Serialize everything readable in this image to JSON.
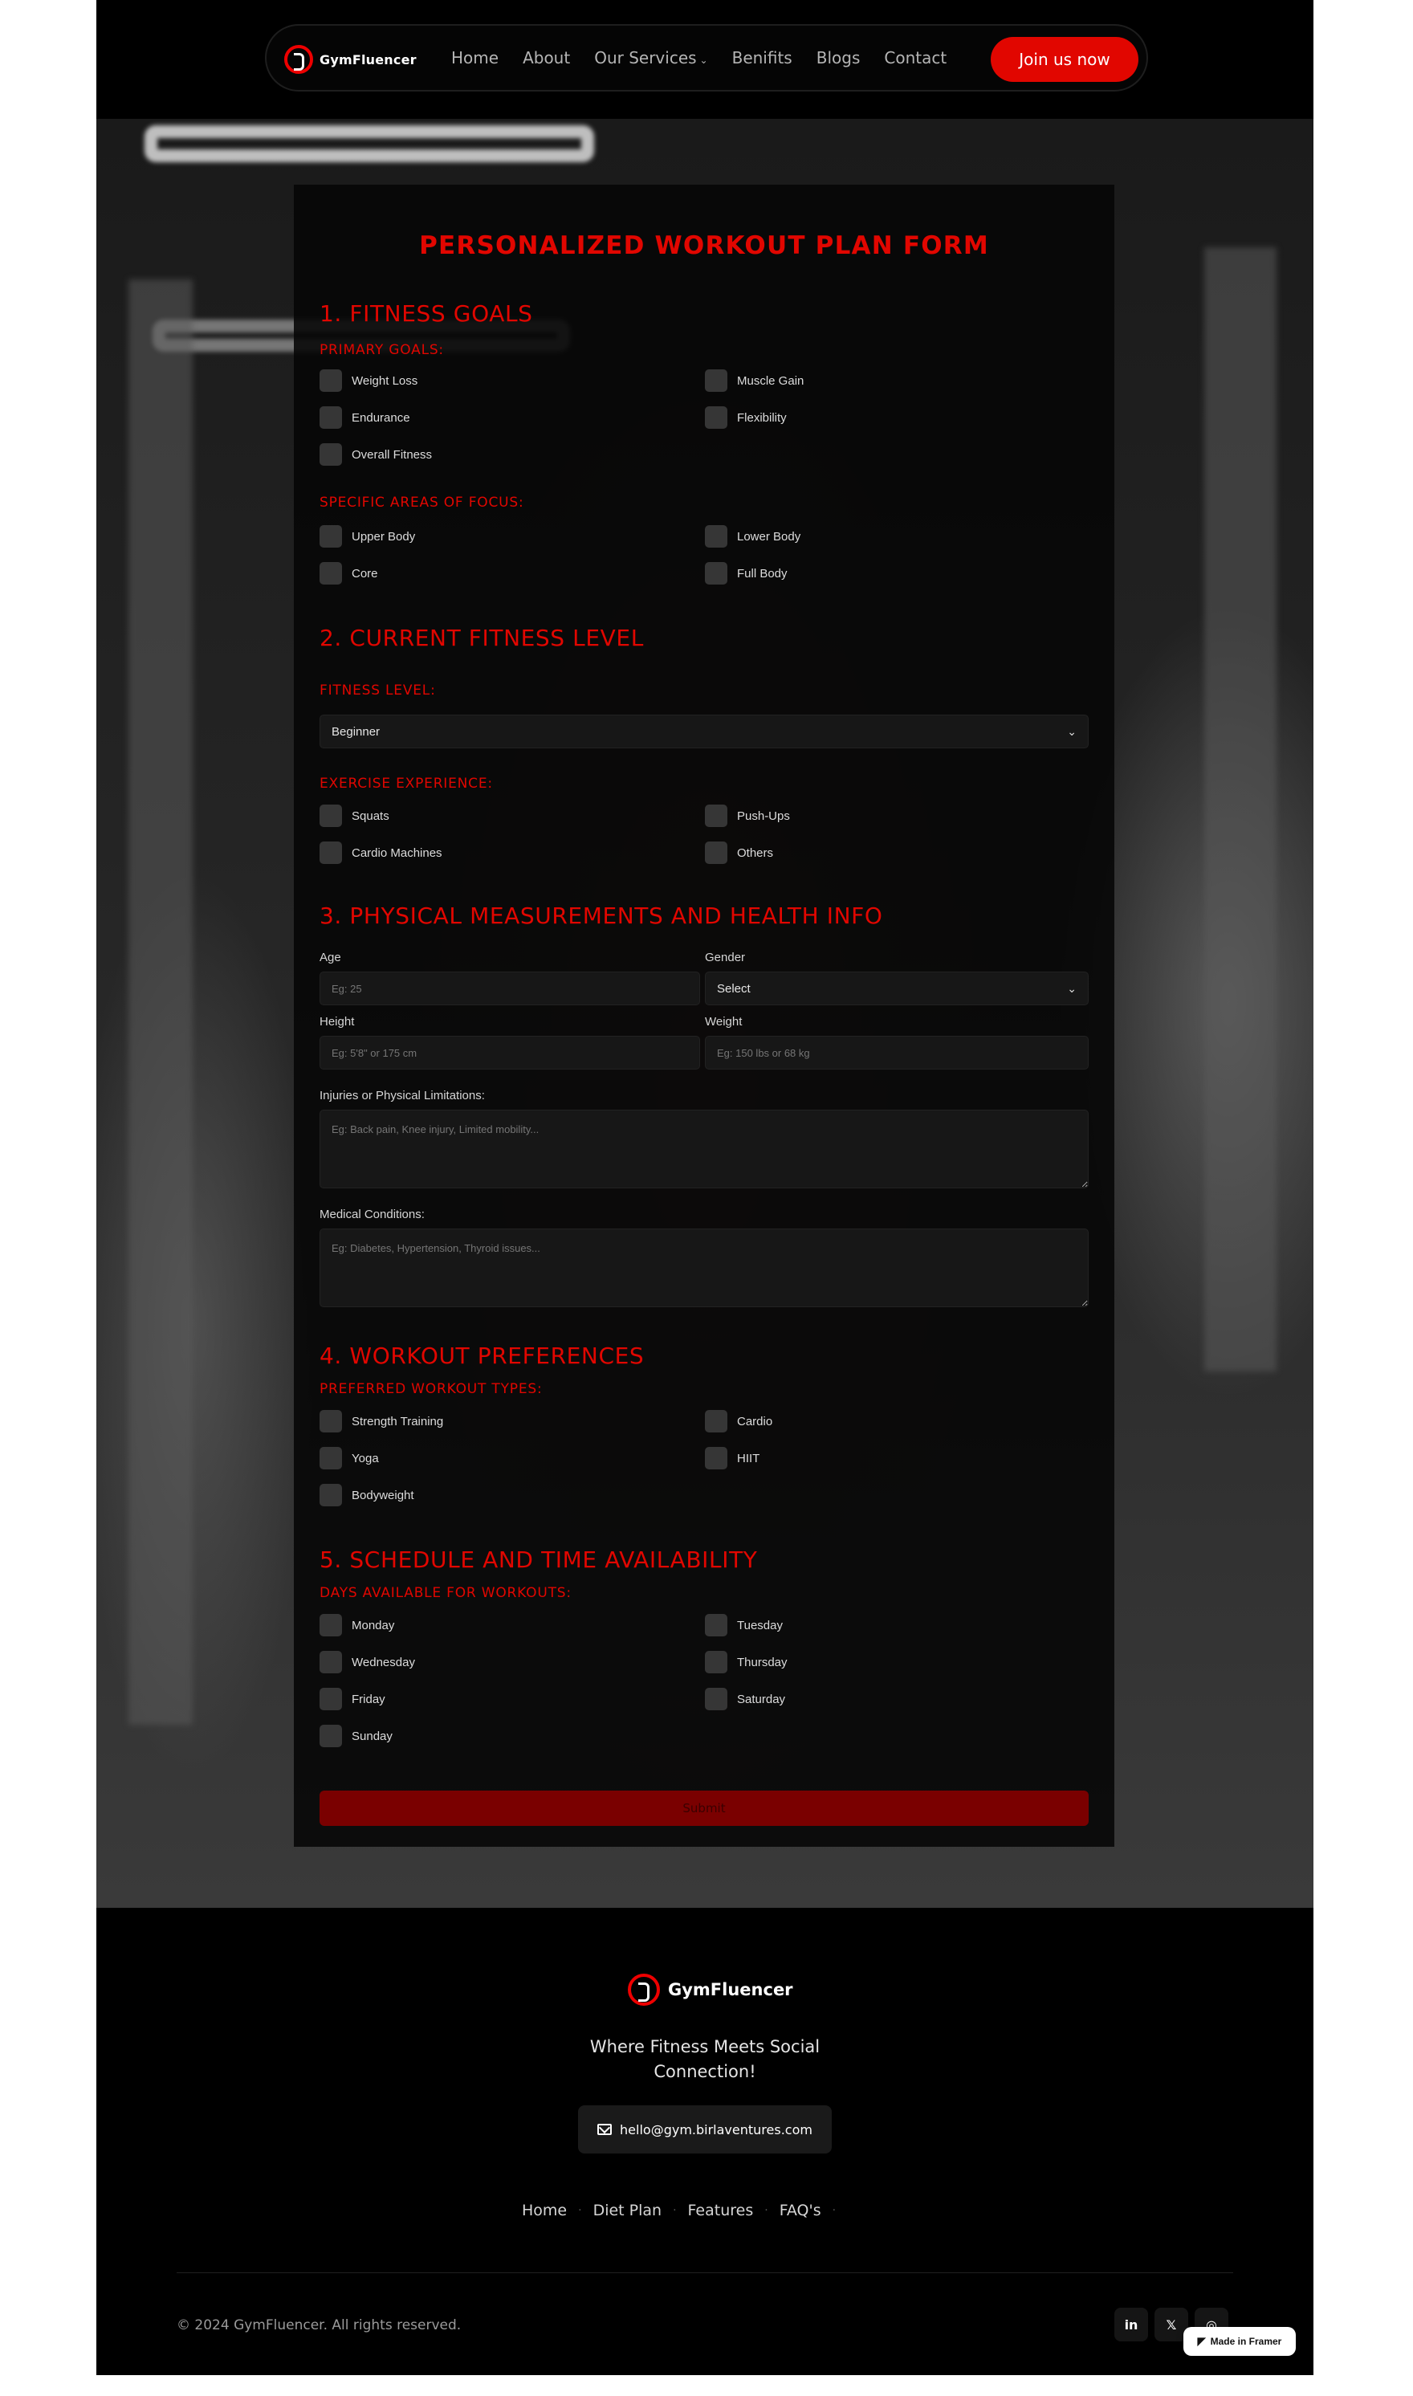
{
  "nav": {
    "brand": "GymFluencer",
    "links": [
      "Home",
      "About",
      "Our Services",
      "Benifits",
      "Blogs",
      "Contact"
    ],
    "join_label": "Join us now"
  },
  "form": {
    "title": "PERSONALIZED WORKOUT PLAN FORM",
    "s1": {
      "heading": "1. FITNESS GOALS",
      "primary_label": "PRIMARY GOALS:",
      "primary": [
        "Weight Loss",
        "Muscle Gain",
        "Endurance",
        "Flexibility",
        "Overall Fitness"
      ],
      "focus_label": "SPECIFIC AREAS OF FOCUS:",
      "focus": [
        "Upper Body",
        "Lower Body",
        "Core",
        "Full Body"
      ]
    },
    "s2": {
      "heading": "2. CURRENT FITNESS LEVEL",
      "level_label": "FITNESS LEVEL:",
      "level_value": "Beginner",
      "exp_label": "EXERCISE EXPERIENCE:",
      "exp": [
        "Squats",
        "Push-Ups",
        "Cardio Machines",
        "Others"
      ]
    },
    "s3": {
      "heading": "3. PHYSICAL MEASUREMENTS AND HEALTH INFO",
      "age_label": "Age",
      "age_placeholder": "Eg: 25",
      "gender_label": "Gender",
      "gender_value": "Select",
      "height_label": "Height",
      "height_placeholder": "Eg: 5'8\" or 175 cm",
      "weight_label": "Weight",
      "weight_placeholder": "Eg: 150 lbs or 68 kg",
      "injuries_label": "Injuries or Physical Limitations:",
      "injuries_placeholder": "Eg: Back pain, Knee injury, Limited mobility...",
      "medical_label": "Medical Conditions:",
      "medical_placeholder": "Eg: Diabetes, Hypertension, Thyroid issues..."
    },
    "s4": {
      "heading": "4. WORKOUT PREFERENCES",
      "types_label": "PREFERRED WORKOUT TYPES:",
      "types": [
        "Strength Training",
        "Cardio",
        "Yoga",
        "HIIT",
        "Bodyweight"
      ]
    },
    "s5": {
      "heading": "5. SCHEDULE AND TIME AVAILABILITY",
      "days_label": "DAYS AVAILABLE FOR WORKOUTS:",
      "days": [
        "Monday",
        "Tuesday",
        "Wednesday",
        "Thursday",
        "Friday",
        "Saturday",
        "Sunday"
      ]
    },
    "submit_label": "Submit"
  },
  "footer": {
    "brand": "GymFluencer",
    "tagline": "Where Fitness Meets Social Connection!",
    "email": "hello@gym.birlaventures.com",
    "links": [
      "Home",
      "Diet Plan",
      "Features",
      "FAQ's"
    ],
    "copyright": "© 2024 GymFluencer. All rights reserved.",
    "social": [
      "linkedin-icon",
      "x-icon",
      "instagram-icon"
    ]
  },
  "badge": {
    "label": "Made in Framer"
  }
}
